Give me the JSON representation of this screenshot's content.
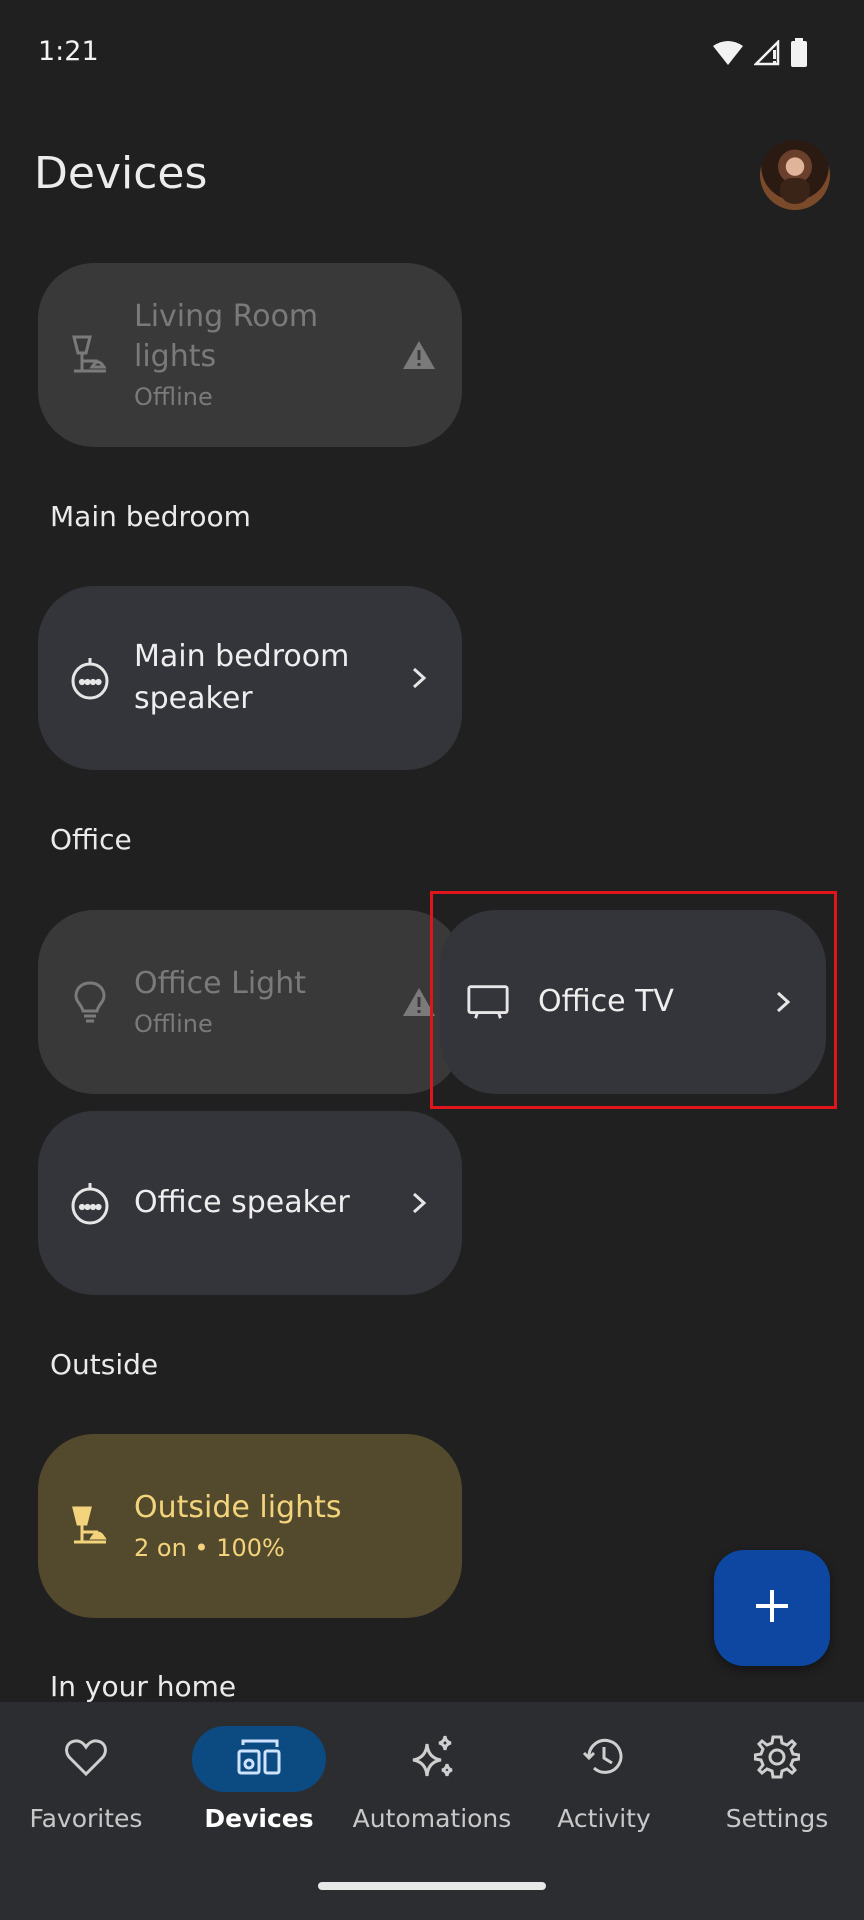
{
  "status_bar": {
    "time": "1:21"
  },
  "header": {
    "title": "Devices"
  },
  "sections": {
    "main_bedroom": "Main bedroom",
    "office": "Office",
    "outside": "Outside",
    "in_your_home": "In your home"
  },
  "devices": {
    "living_room": {
      "name_line1": "Living Room",
      "name_line2": "lights",
      "status": "Offline",
      "icon": "lamp-icon",
      "state": "offline"
    },
    "main_bedroom_speaker": {
      "name_line1": "Main bedroom",
      "name_line2": "speaker",
      "icon": "speaker-icon"
    },
    "office_light": {
      "name": "Office Light",
      "status": "Offline",
      "icon": "bulb-icon",
      "state": "offline"
    },
    "office_tv": {
      "name": "Office TV",
      "icon": "tv-icon"
    },
    "office_speaker": {
      "name": "Office speaker",
      "icon": "speaker-icon"
    },
    "outside_lights": {
      "name": "Outside lights",
      "status": "2 on • 100%",
      "icon": "lamp-icon",
      "state": "on"
    }
  },
  "bottom_nav": {
    "items": [
      {
        "label": "Favorites",
        "icon": "heart-icon"
      },
      {
        "label": "Devices",
        "icon": "devices-icon",
        "selected": true
      },
      {
        "label": "Automations",
        "icon": "sparkle-icon"
      },
      {
        "label": "Activity",
        "icon": "history-icon"
      },
      {
        "label": "Settings",
        "icon": "gear-icon"
      }
    ]
  },
  "colors": {
    "background": "#202020",
    "tile": "#34353b",
    "tile_offline": "#393939",
    "tile_active": "#534a2d",
    "active_text": "#f3d37b",
    "fab": "#0d47a1",
    "nav_selected": "#0c4a82",
    "highlight": "#e0141b"
  }
}
